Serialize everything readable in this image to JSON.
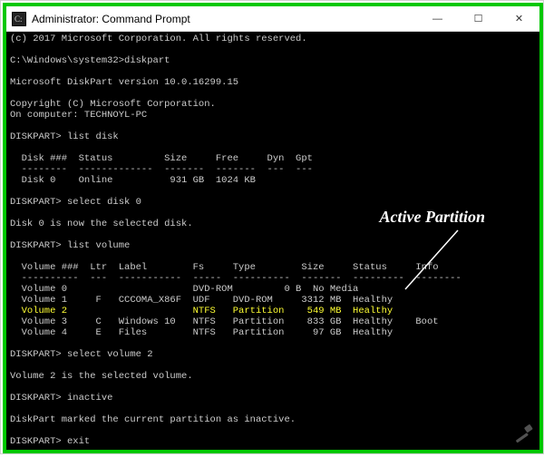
{
  "window": {
    "title": "Administrator: Command Prompt"
  },
  "winbtns": {
    "min": "—",
    "max": "☐",
    "close": "✕"
  },
  "term": {
    "copyright1": "(c) 2017 Microsoft Corporation. All rights reserved.",
    "prompt1": "C:\\Windows\\system32>diskpart",
    "version": "Microsoft DiskPart version 10.0.16299.15",
    "copyright2": "Copyright (C) Microsoft Corporation.",
    "computer": "On computer: TECHNOYL-PC",
    "prompt2": "DISKPART> list disk",
    "diskhdr": "  Disk ###  Status         Size     Free     Dyn  Gpt",
    "diskline": "  --------  -------------  -------  -------  ---  ---",
    "disk0": "  Disk 0    Online          931 GB  1024 KB",
    "prompt3": "DISKPART> select disk 0",
    "selected_disk": "Disk 0 is now the selected disk.",
    "prompt4": "DISKPART> list volume",
    "volhdr": "  Volume ###  Ltr  Label        Fs     Type        Size     Status     Info",
    "volline": "  ----------  ---  -----------  -----  ----------  -------  ---------  --------",
    "vol0": "  Volume 0                      DVD-ROM         0 B  No Media",
    "vol1": "  Volume 1     F   CCCOMA_X86F  UDF    DVD-ROM     3312 MB  Healthy",
    "vol2": "  Volume 2                      NTFS   Partition    549 MB  Healthy",
    "vol3": "  Volume 3     C   Windows 10   NTFS   Partition    833 GB  Healthy    Boot",
    "vol4": "  Volume 4     E   Files        NTFS   Partition     97 GB  Healthy",
    "prompt5": "DISKPART> select volume 2",
    "selected_vol": "Volume 2 is the selected volume.",
    "prompt6": "DISKPART> inactive",
    "inactive_msg": "DiskPart marked the current partition as inactive.",
    "prompt7": "DISKPART> exit"
  },
  "annotation": {
    "label": "Active Partition"
  }
}
